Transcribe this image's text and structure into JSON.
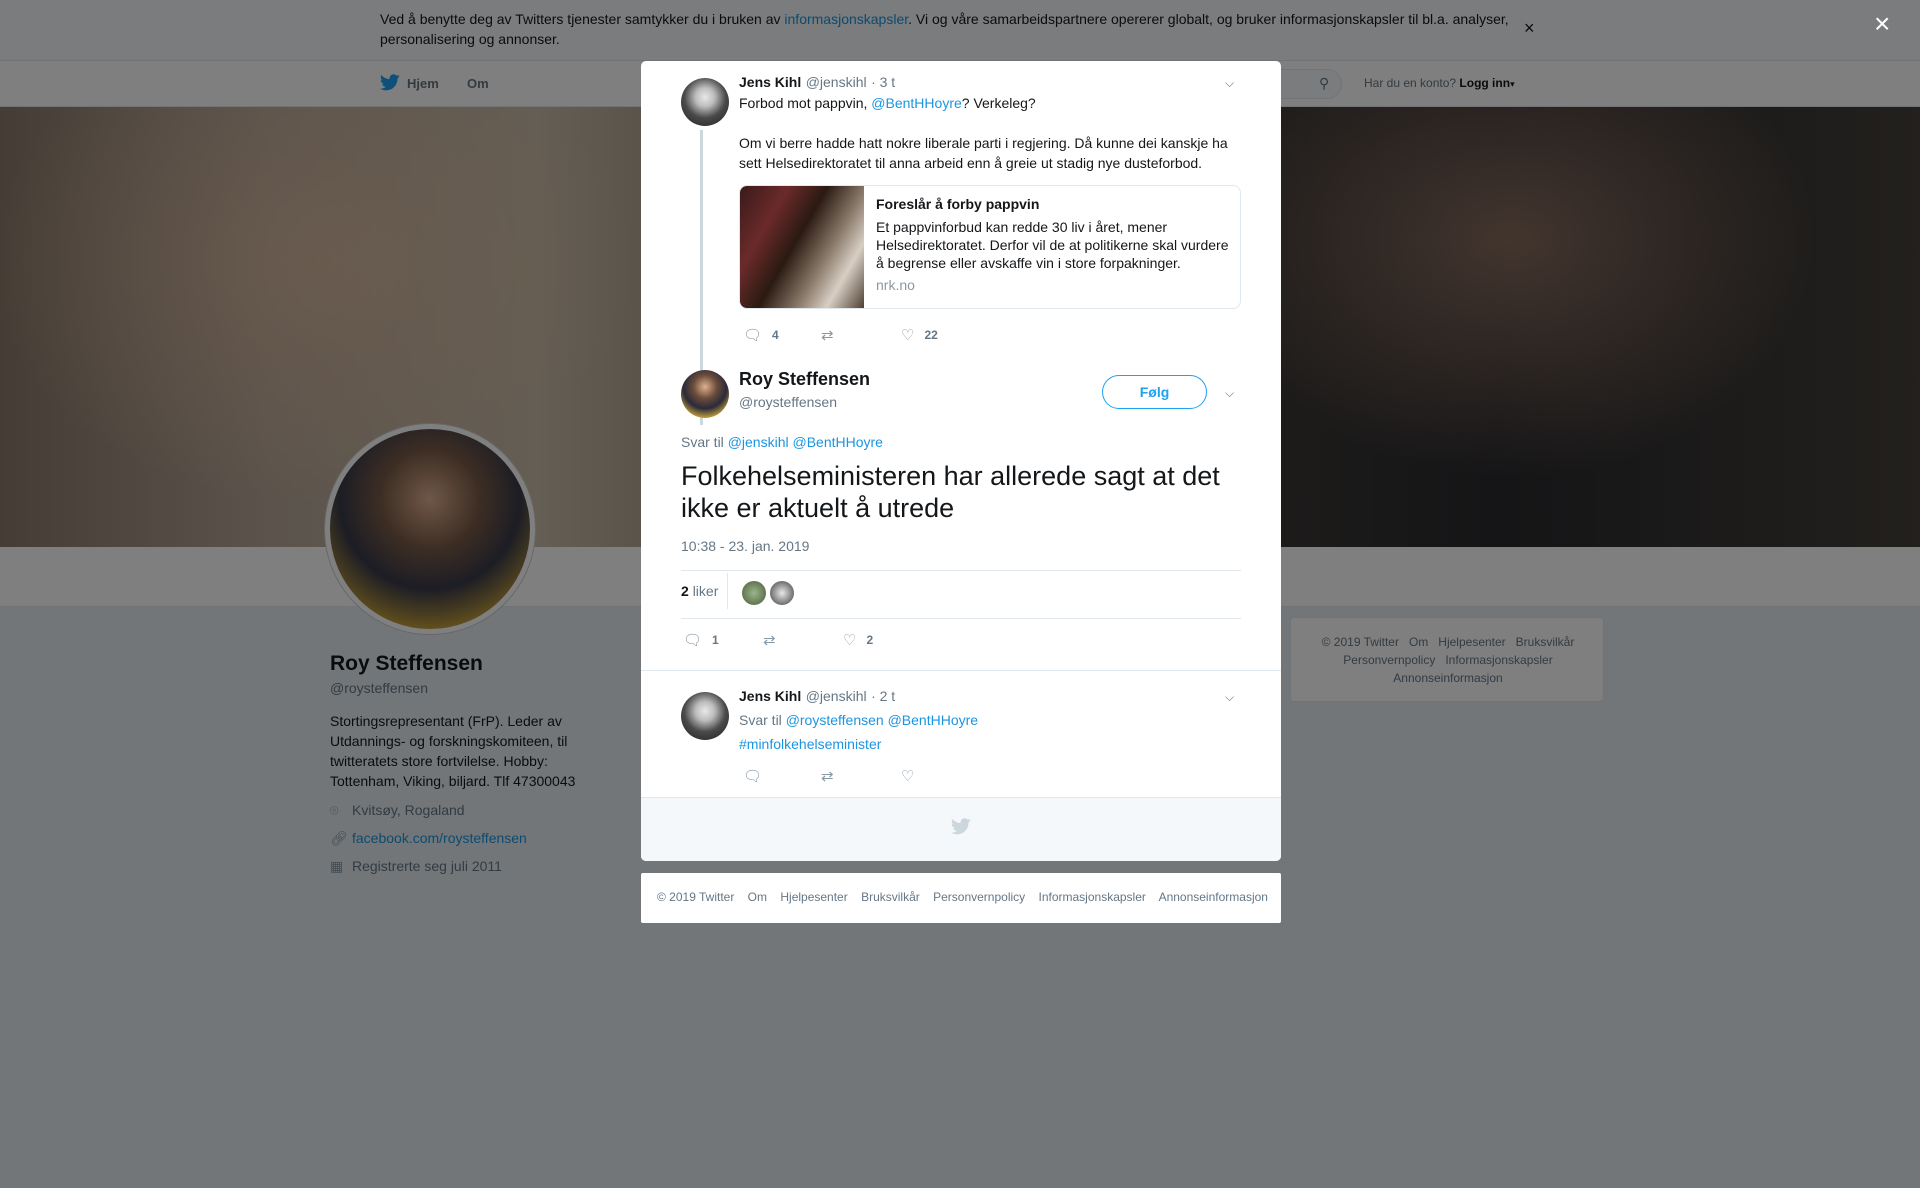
{
  "cookie_bar": {
    "text_before": "Ved å benytte deg av Twitters tjenester samtykker du i bruken av ",
    "link": "informasjonskapsler",
    "text_after": ". Vi og våre samarbeidspartnere opererer globalt, og bruker informasjonskapsler til bl.a. analyser, personalisering og annonser.",
    "close": "×"
  },
  "topnav": {
    "home": "Hjem",
    "about": "Om",
    "account_question": "Har du en konto?",
    "login": "Logg inn"
  },
  "profile": {
    "name": "Roy Steffensen",
    "handle": "@roysteffensen",
    "bio": "Stortingsrepresentant (FrP). Leder av Utdannings- og forskningskomiteen, til twitteratets store fortvilelse. Hobby: Tottenham, Viking, biljard. Tlf 47300043",
    "location": "Kvitsøy, Rogaland",
    "website": "facebook.com/roysteffensen",
    "joined": "Registrerte seg juli 2011"
  },
  "right_footer": {
    "line1": [
      "© 2019 Twitter",
      "Om",
      "Hjelpesenter",
      "Bruksvilkår"
    ],
    "line2": [
      "Personvernpolicy",
      "Informasjonskapsler"
    ],
    "line3": [
      "Annonseinformasjon"
    ]
  },
  "overlay_close": "×",
  "modal": {
    "parent_tweet": {
      "name": "Jens Kihl",
      "handle": "@jenskihl",
      "time": "· 3 t",
      "text_line1_before": "Forbod mot pappvin, ",
      "text_line1_mention": "@BentHHoyre",
      "text_line1_after": "? Verkeleg?",
      "text_para2": "Om vi berre hadde hatt nokre liberale parti i regjering. Då kunne dei kanskje ha sett Helsedirektoratet til anna arbeid enn å greie ut stadig nye dusteforbod.",
      "card": {
        "title": "Foreslår å forby pappvin",
        "description": "Et pappvinforbud kan redde 30 liv i året, mener Helsedirektoratet. Derfor vil de at politikerne skal vurdere å begrense eller avskaffe vin i store forpakninger.",
        "domain": "nrk.no"
      },
      "replies": "4",
      "retweets": "",
      "likes": "22"
    },
    "main_tweet": {
      "name": "Roy Steffensen",
      "handle": "@roysteffensen",
      "follow": "Følg",
      "reply_to_label": "Svar til",
      "reply_to_mentions": "@jenskihl @BentHHoyre",
      "text": "Folkehelseministeren har allerede sagt at det ikke er aktuelt å utrede",
      "timestamp": "10:38 - 23. jan. 2019",
      "likes_count": "2",
      "likes_label": "liker",
      "replies": "1",
      "retweets": "",
      "likes": "2"
    },
    "reply_tweet": {
      "name": "Jens Kihl",
      "handle": "@jenskihl",
      "time": "· 2 t",
      "reply_to_label": "Svar til",
      "reply_to_mentions": "@roysteffensen @BentHHoyre",
      "hashtag": "#minfolkehelseminister"
    }
  },
  "modal_footer": [
    "© 2019 Twitter",
    "Om",
    "Hjelpesenter",
    "Bruksvilkår",
    "Personvernpolicy",
    "Informasjonskapsler",
    "Annonseinformasjon"
  ],
  "colors": {
    "accent": "#1da1f2",
    "link": "#1b95e0",
    "overlay": "rgba(0,0,0,0.5)"
  },
  "icons": [
    "twitter-bird-icon",
    "search-icon",
    "caret-down-icon",
    "location-icon",
    "link-icon",
    "calendar-icon",
    "reply-icon",
    "retweet-icon",
    "heart-icon",
    "chevron-down-icon",
    "close-icon"
  ]
}
